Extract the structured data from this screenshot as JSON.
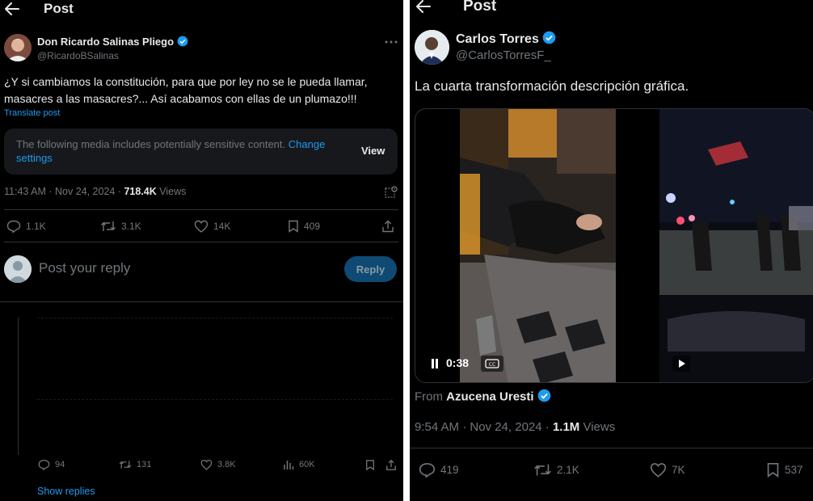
{
  "left": {
    "header_title": "Post",
    "author_name": "Don Ricardo Salinas Pliego",
    "author_handle": "@RicardoBSalinas",
    "tweet_text": "¿Y si cambiamos la constitución, para que por ley no se le pueda llamar, masacres a las masacres?... Así acabamos con ellas de un plumazo!!!",
    "translate_label": "Translate post",
    "sensitive_text": "The following media includes potentially sensitive content.",
    "sensitive_link": "Change settings",
    "view_label": "View",
    "timestamp": "11:43 AM · Nov 24, 2024 · ",
    "views_count": "718.4K",
    "views_label": " Views",
    "actions": {
      "replies": "1.1K",
      "reposts": "3.1K",
      "likes": "14K",
      "bookmarks": "409"
    },
    "reply_placeholder": "Post your reply",
    "reply_button": "Reply",
    "reply_actions": {
      "replies": "94",
      "reposts": "131",
      "likes": "3.8K",
      "views": "60K"
    },
    "show_replies": "Show replies"
  },
  "right": {
    "header_title": "Post",
    "author_name": "Carlos Torres",
    "author_handle": "@CarlosTorresF_",
    "tweet_text": "La cuarta transformación descripción gráfica.",
    "video_time": "0:38",
    "from_label": "From",
    "from_name": "Azucena Uresti",
    "timestamp": "9:54 AM · Nov 24, 2024 · ",
    "views_count": "1.1M",
    "views_label": " Views",
    "actions": {
      "replies": "419",
      "reposts": "2.1K",
      "likes": "7K",
      "bookmarks": "537"
    }
  },
  "colors": {
    "accent": "#1d9bf0",
    "muted": "#71767b",
    "background": "#000000",
    "text": "#e7e9ea"
  }
}
